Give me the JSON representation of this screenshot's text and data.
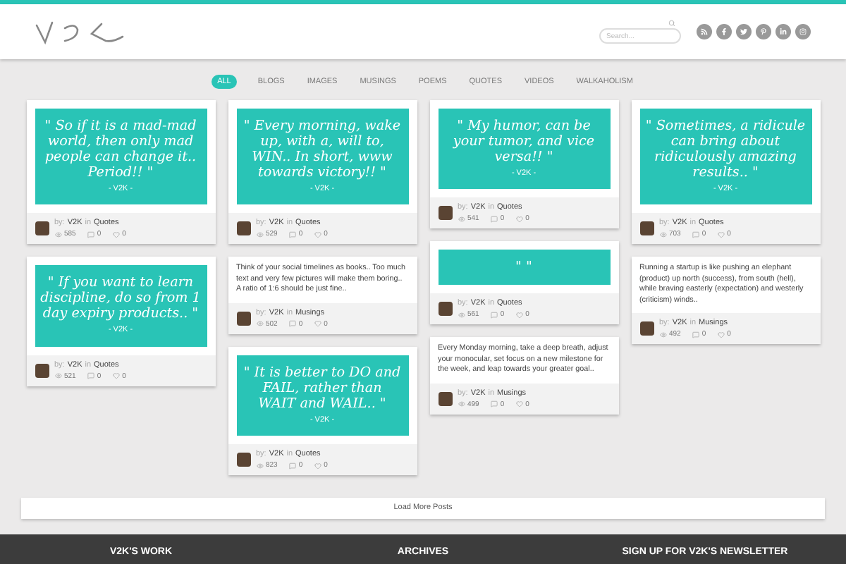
{
  "header": {
    "search": {
      "placeholder": "Search..."
    },
    "social": [
      {
        "kind": "rss"
      },
      {
        "kind": "facebook"
      },
      {
        "kind": "twitter"
      },
      {
        "kind": "pinterest"
      },
      {
        "kind": "linkedin"
      },
      {
        "kind": "instagram"
      }
    ]
  },
  "filters": [
    {
      "label": "ALL",
      "selected": true
    },
    {
      "label": "BLOGS",
      "selected": false
    },
    {
      "label": "IMAGES",
      "selected": false
    },
    {
      "label": "MUSINGS",
      "selected": false
    },
    {
      "label": "POEMS",
      "selected": false
    },
    {
      "label": "QUOTES",
      "selected": false
    },
    {
      "label": "VIDEOS",
      "selected": false
    },
    {
      "label": "WALKAHOLISM",
      "selected": false
    }
  ],
  "columns": [
    [
      {
        "kind": "quote",
        "text": "\" So if it is a mad-mad world, then only mad people can change it.. Period!! \"",
        "signature": "- V2K -",
        "by": "by:",
        "author": "V2K",
        "in": "in",
        "category": "Quotes",
        "views": "585",
        "comments": "0",
        "likes": "0"
      },
      {
        "kind": "quote",
        "text": "\" If you want to learn discipline, do so from 1 day expiry products.. \"",
        "signature": "- V2K -",
        "by": "by:",
        "author": "V2K",
        "in": "in",
        "category": "Quotes",
        "views": "521",
        "comments": "0",
        "likes": "0"
      }
    ],
    [
      {
        "kind": "quote",
        "text": "\" Every morning, wake up, with a, will to, WIN.. In short, www towards victory!! \"",
        "signature": "- V2K -",
        "by": "by:",
        "author": "V2K",
        "in": "in",
        "category": "Quotes",
        "views": "529",
        "comments": "0",
        "likes": "0"
      },
      {
        "kind": "text",
        "text": "Think of your social timelines as books.. Too much text and very few pictures will make them boring.. A ratio of 1:6 should be just fine..",
        "by": "by:",
        "author": "V2K",
        "in": "in",
        "category": "Musings",
        "views": "502",
        "comments": "0",
        "likes": "0"
      },
      {
        "kind": "quote",
        "text": "\" It is better to DO and FAIL, rather than WAIT and WAIL.. \"",
        "signature": "- V2K -",
        "by": "by:",
        "author": "V2K",
        "in": "in",
        "category": "Quotes",
        "views": "823",
        "comments": "0",
        "likes": "0"
      }
    ],
    [
      {
        "kind": "quote",
        "text": "\" My humor, can be your tumor, and vice versa!! \"",
        "signature": "- V2K -",
        "by": "by:",
        "author": "V2K",
        "in": "in",
        "category": "Quotes",
        "views": "541",
        "comments": "0",
        "likes": "0"
      },
      {
        "kind": "quote",
        "text": "\" \"",
        "by": "by:",
        "author": "V2K",
        "in": "in",
        "category": "Quotes",
        "views": "561",
        "comments": "0",
        "likes": "0"
      },
      {
        "kind": "text",
        "text": "Every Monday morning, take a deep breath, adjust your monocular, set focus on a new milestone for the week, and leap towards your greater goal..",
        "by": "by:",
        "author": "V2K",
        "in": "in",
        "category": "Musings",
        "views": "499",
        "comments": "0",
        "likes": "0"
      }
    ],
    [
      {
        "kind": "quote",
        "text": "\" Sometimes, a ridicule can bring about ridiculously amazing results.. \"",
        "signature": "- V2K -",
        "by": "by:",
        "author": "V2K",
        "in": "in",
        "category": "Quotes",
        "views": "703",
        "comments": "0",
        "likes": "0"
      },
      {
        "kind": "text",
        "text": "Running a startup is like pushing an elephant (product) up north (success), from south (hell), while braving easterly (expectation) and westerly (criticism) winds..",
        "by": "by:",
        "author": "V2K",
        "in": "in",
        "category": "Musings",
        "views": "492",
        "comments": "0",
        "likes": "0"
      }
    ]
  ],
  "load_more": "Load More Posts",
  "footer": {
    "headings": [
      "V2K'S WORK",
      "ARCHIVES",
      "SIGN UP FOR V2K'S NEWSLETTER"
    ]
  }
}
